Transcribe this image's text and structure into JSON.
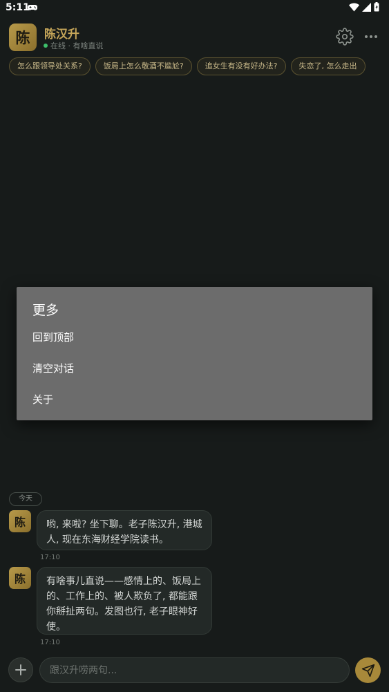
{
  "status_bar": {
    "time": "5:11",
    "icons": [
      "gamepad-icon",
      "wifi-icon",
      "signal-icon",
      "battery-icon"
    ]
  },
  "header": {
    "avatar_char": "陈",
    "name": "陈汉升",
    "presence": "在线 · 有啥直说",
    "icons": [
      "settings-icon",
      "more-icon"
    ]
  },
  "suggestions": [
    "怎么跟领导处关系?",
    "饭局上怎么敬酒不尴尬?",
    "追女生有没有好办法?",
    "失恋了, 怎么走出"
  ],
  "chat": {
    "day_label": "今天",
    "messages": [
      {
        "avatar_char": "陈",
        "text": "哟, 来啦? 坐下聊。老子陈汉升, 港城人, 现在东海财经学院读书。",
        "time": "17:10"
      },
      {
        "avatar_char": "陈",
        "text": "有啥事儿直说——感情上的、饭局上的、工作上的、被人欺负了, 都能跟你掰扯两句。发图也行, 老子眼神好使。",
        "time": "17:10"
      }
    ]
  },
  "composer": {
    "placeholder": "跟汉升唠两句...",
    "icons": [
      "plus-icon",
      "send-icon"
    ]
  },
  "dialog": {
    "title": "更多",
    "items": [
      "回到顶部",
      "清空对话",
      "关于"
    ]
  },
  "colors": {
    "background": "#171b1a",
    "accent_gold": "#c6a659",
    "dialog_bg": "#6c6c6c",
    "online": "#3dbf6b"
  }
}
